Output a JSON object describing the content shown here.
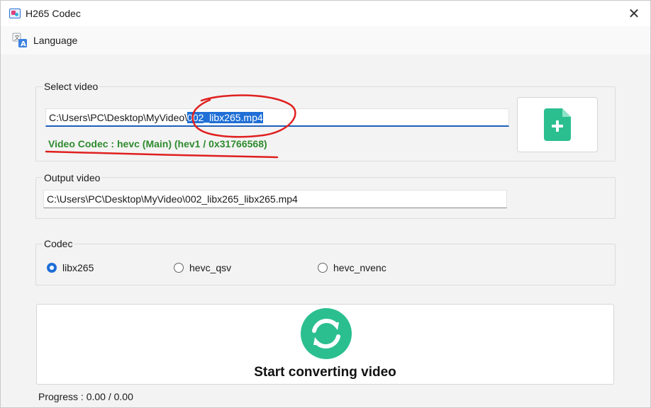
{
  "window": {
    "title": "H265 Codec",
    "close_glyph": "✕"
  },
  "menu": {
    "language_label": "Language",
    "language_icon": "translate-icon"
  },
  "select_video": {
    "label": "Select video",
    "path_prefix": "C:\\Users\\PC\\Desktop\\MyVideo\\",
    "path_selected": "002_libx265.mp4",
    "codec_info": "Video Codec : hevc (Main)  (hev1 / 0x31766568)",
    "add_button_icon": "file-add-icon",
    "accent_color": "#2bbf8f"
  },
  "output_video": {
    "label": "Output video",
    "path": "C:\\Users\\PC\\Desktop\\MyVideo\\002_libx265_libx265.mp4"
  },
  "codec": {
    "label": "Codec",
    "options": [
      {
        "label": "libx265",
        "selected": true
      },
      {
        "label": "hevc_qsv",
        "selected": false
      },
      {
        "label": "hevc_nvenc",
        "selected": false
      }
    ]
  },
  "convert": {
    "label": "Start converting video",
    "icon": "sync-icon"
  },
  "progress": {
    "text": "Progress : 0.00 / 0.00"
  },
  "annotation_color": "#e02020"
}
